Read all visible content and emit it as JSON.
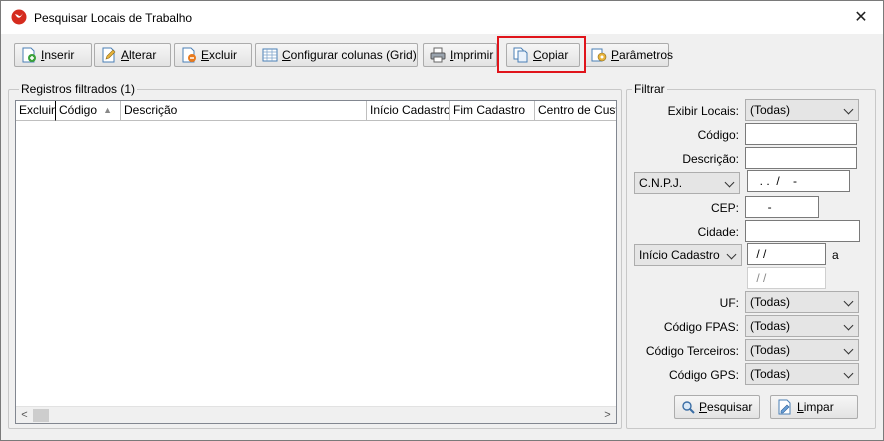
{
  "window": {
    "title": "Pesquisar Locais de Trabalho",
    "close_glyph": "✕"
  },
  "toolbar": {
    "inserir": "Inserir",
    "alterar": "Alterar",
    "excluir": "Excluir",
    "configurar": "Configurar colunas (Grid)",
    "imprimir": "Imprimir",
    "copiar": "Copiar",
    "parametros": "Parâmetros"
  },
  "registros": {
    "title": "Registros filtrados (1)",
    "columns": [
      "Excluir",
      "Código",
      "Descrição",
      "Início Cadastro",
      "Fim Cadastro",
      "Centro de Cust"
    ],
    "rows": []
  },
  "filtrar": {
    "title": "Filtrar",
    "exibir_locais_label": "Exibir Locais:",
    "exibir_locais_value": "(Todas)",
    "codigo_label": "Código:",
    "codigo_value": "",
    "descricao_label": "Descrição:",
    "descricao_value": "",
    "doc_type_value": "C.N.P.J.",
    "cnpj_mask": "  . .  /    -",
    "cep_label": "CEP:",
    "cep_mask": "     -",
    "cidade_label": "Cidade:",
    "cidade_value": "",
    "data_type_value": "Início Cadastro",
    "data_inicio_mask": " / /",
    "a_label": "a",
    "data_fim_mask": " / /",
    "uf_label": "UF:",
    "uf_value": "(Todas)",
    "fpas_label": "Código FPAS:",
    "fpas_value": "(Todas)",
    "terceiros_label": "Código Terceiros:",
    "terceiros_value": "(Todas)",
    "gps_label": "Código GPS:",
    "gps_value": "(Todas)",
    "pesquisar": "Pesquisar",
    "limpar": "Limpar"
  },
  "colors": {
    "highlight": "#e0141b",
    "brand_icon": "#d52b1e"
  }
}
